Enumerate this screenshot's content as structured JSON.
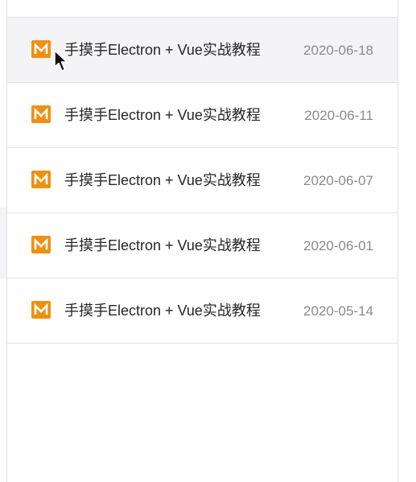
{
  "files": [
    {
      "title": "手摸手Electron + Vue实战教程",
      "date": "2020-06-18",
      "icon": "markdown-file-icon",
      "active": true
    },
    {
      "title": "手摸手Electron + Vue实战教程",
      "date": "2020-06-11",
      "icon": "markdown-file-icon",
      "active": false
    },
    {
      "title": "手摸手Electron + Vue实战教程",
      "date": "2020-06-07",
      "icon": "markdown-file-icon",
      "active": false
    },
    {
      "title": "手摸手Electron + Vue实战教程",
      "date": "2020-06-01",
      "icon": "markdown-file-icon",
      "active": false
    },
    {
      "title": "手摸手Electron + Vue实战教程",
      "date": "2020-05-14",
      "icon": "markdown-file-icon",
      "active": false
    }
  ],
  "colors": {
    "icon_bg": "#f0900f",
    "active_row_bg": "#f4f4f6",
    "title_text": "#262626",
    "date_text": "#8a8a8f",
    "divider": "#e3e3e6"
  }
}
